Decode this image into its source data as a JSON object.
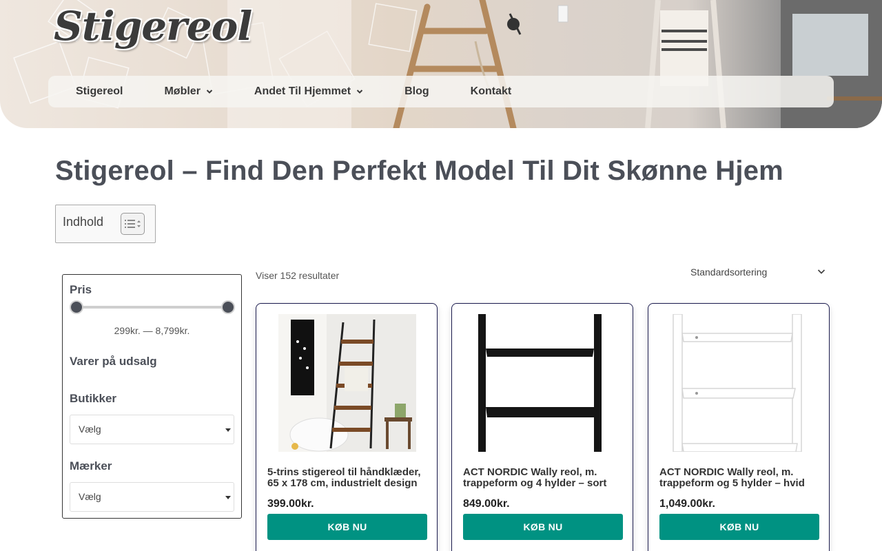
{
  "site": {
    "logo": "Stigereol"
  },
  "nav": {
    "items": [
      {
        "label": "Stigereol",
        "has_dropdown": false
      },
      {
        "label": "Møbler",
        "has_dropdown": true
      },
      {
        "label": "Andet Til Hjemmet",
        "has_dropdown": true
      },
      {
        "label": "Blog",
        "has_dropdown": false
      },
      {
        "label": "Kontakt",
        "has_dropdown": false
      }
    ]
  },
  "page": {
    "title": "Stigereol – Find Den Perfekt Model Til Dit Skønne Hjem"
  },
  "toc": {
    "label": "Indhold",
    "icon": "list-toggle-icon"
  },
  "filters": {
    "price_heading": "Pris",
    "price_range": "299kr. — 8,799kr.",
    "price_min_fraction": 0,
    "price_max_fraction": 1,
    "sale_heading": "Varer på udsalg",
    "stores_heading": "Butikker",
    "stores_select": "Vælg",
    "brands_heading": "Mærker",
    "brands_select": "Vælg"
  },
  "results": {
    "count_text": "Viser 152 resultater",
    "sort_selected": "Standardsortering"
  },
  "products": [
    {
      "title": "5-trins stigereol til håndklæder, 65 x 178 cm, industrielt design",
      "price": "399.00kr.",
      "button": "KØB NU",
      "image": "ladder-towel-rack-photo"
    },
    {
      "title": "ACT NORDIC Wally reol, m. trappeform og 4 hylder – sort",
      "price": "849.00kr.",
      "button": "KØB NU",
      "image": "black-ladder-shelf-photo"
    },
    {
      "title": "ACT NORDIC Wally reol, m. trappeform og 5 hylder – hvid",
      "price": "1,049.00kr.",
      "button": "KØB NU",
      "image": "white-ladder-shelf-photo"
    }
  ],
  "colors": {
    "accent": "#009282",
    "text": "#4b4f58",
    "card_border": "#1a1a4d"
  }
}
